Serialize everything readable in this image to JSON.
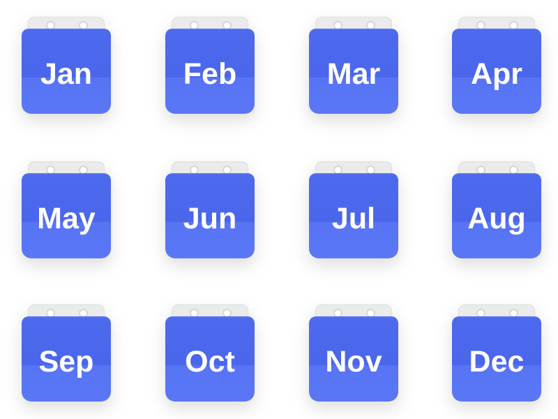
{
  "months": [
    {
      "label": "Jan"
    },
    {
      "label": "Feb"
    },
    {
      "label": "Mar"
    },
    {
      "label": "Apr"
    },
    {
      "label": "May"
    },
    {
      "label": "Jun"
    },
    {
      "label": "Jul"
    },
    {
      "label": "Aug"
    },
    {
      "label": "Sep"
    },
    {
      "label": "Oct"
    },
    {
      "label": "Nov"
    },
    {
      "label": "Dec"
    }
  ],
  "colors": {
    "page_top": "#4a66ec",
    "page_bottom": "#5a77f6",
    "ring_tab": "#ebebeb",
    "text": "#ffffff",
    "background": "#ffffff"
  }
}
